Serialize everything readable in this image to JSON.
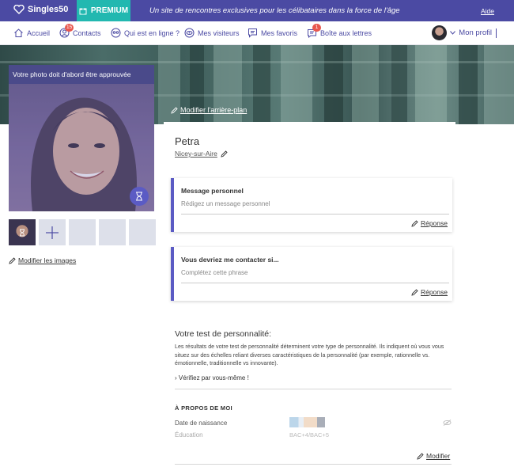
{
  "topbar": {
    "brand": "Singles50",
    "premium": "PREMIUM",
    "tagline": "Un site de rencontres exclusives pour les célibataires dans la force de l'âge",
    "help": "Aide"
  },
  "nav": {
    "items": [
      {
        "label": "Accueil",
        "icon": "home-icon"
      },
      {
        "label": "Contacts",
        "icon": "contacts-icon",
        "badge": "15"
      },
      {
        "label": "Qui est en ligne ?",
        "icon": "online-icon"
      },
      {
        "label": "Mes visiteurs",
        "icon": "eye-icon"
      },
      {
        "label": "Mes favoris",
        "icon": "chat-icon"
      },
      {
        "label": "Boîte aux lettres",
        "icon": "mail-icon",
        "badge": "1"
      }
    ],
    "profile": "Mon profil"
  },
  "banner": {
    "edit_background": "Modifier l'arrière-plan"
  },
  "photo": {
    "notice": "Votre photo doit d'abord être approuvée",
    "edit_images": "Modifier les images"
  },
  "profile": {
    "name": "Petra",
    "city": "Nicey-sur-Aire"
  },
  "cards": {
    "message": {
      "title": "Message personnel",
      "placeholder": "Rédigez un message personnel",
      "reply": "Réponse"
    },
    "contact": {
      "title": "Vous devriez me contacter si...",
      "placeholder": "Complétez cette phrase",
      "reply": "Réponse"
    }
  },
  "personality": {
    "title": "Votre test de personnalité:",
    "text": "Les résultats de votre test de personnalité déterminent votre type de personnalité. Ils indiquent où vous vous situez sur des échelles reliant diverses caractéristiques de la personnalité (par exemple, rationnelle vs. émotionnelle, traditionnelle vs innovante).",
    "check": "Vérifiez par vous-même !"
  },
  "about": {
    "title": "À PROPOS DE MOI",
    "birth_label": "Date de naissance",
    "education_label": "Éducation",
    "education_value": "BAC+4/BAC+5",
    "modify": "Modifier"
  },
  "colors": {
    "brand": "#4b4aa3",
    "premium": "#22b8b0",
    "badge": "#e8574e",
    "accent": "#5b5bc4"
  }
}
